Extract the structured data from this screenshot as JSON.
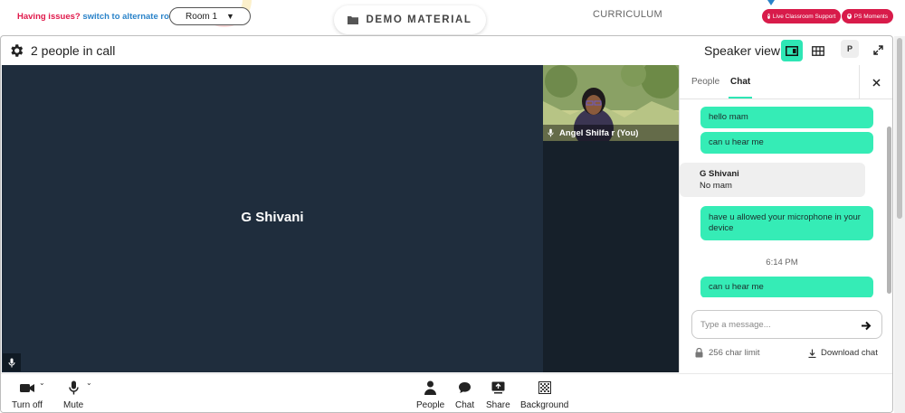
{
  "topbar": {
    "issues_question": "Having issues?",
    "issues_link": "switch to alternate room",
    "room_select": "Room 1",
    "demo_material": "DEMO MATERIAL",
    "curriculum": "CURRICULUM",
    "live_support": "Live Classroom Support",
    "ps_moments": "PS Moments"
  },
  "call": {
    "people_count": "2 people in call",
    "view_label": "Speaker view",
    "p_badge": "P",
    "speaker_name": "G Shivani",
    "self_tile_name": "Angel Shilfa r (You)"
  },
  "chat": {
    "tabs": [
      "People",
      "Chat"
    ],
    "active_tab": "Chat",
    "messages": [
      {
        "type": "out",
        "text": "hello mam"
      },
      {
        "type": "out",
        "text": "can u hear me"
      },
      {
        "type": "in",
        "from": "G Shivani",
        "text": "No mam"
      },
      {
        "type": "out",
        "text": "have u allowed your microphone in your device"
      },
      {
        "type": "time",
        "text": "6:14 PM"
      },
      {
        "type": "out",
        "text": "can u hear me"
      }
    ],
    "input_placeholder": "Type a message...",
    "char_limit": "256 char limit",
    "download": "Download chat"
  },
  "toolbar": {
    "camera": "Turn off",
    "mute": "Mute",
    "people": "People",
    "chat": "Chat",
    "share": "Share",
    "background": "Background"
  },
  "colors": {
    "accent": "#2ee6b5",
    "message_bubble": "#35ecb6",
    "stage_bg": "#1f2d3d",
    "pill_red": "#d81b4a",
    "link_blue": "#2a83c9"
  }
}
